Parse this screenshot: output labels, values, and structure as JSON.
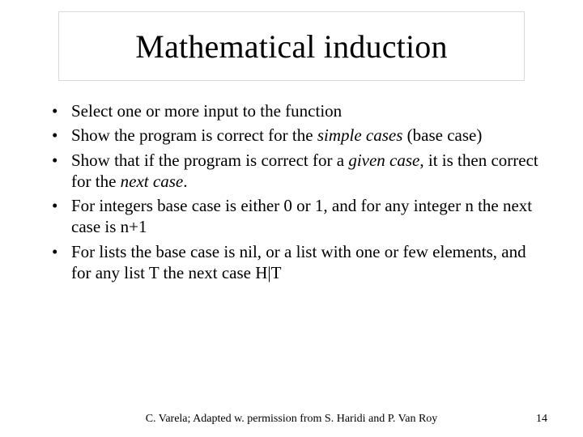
{
  "title": "Mathematical induction",
  "bullets": {
    "b1": "Select one or more input to the function",
    "b2a": "Show the program is correct for the ",
    "b2b": "simple cases",
    "b2c": " (base case)",
    "b3a": "Show that if the program is correct for a ",
    "b3b": "given case",
    "b3c": ", it is then correct for the ",
    "b3d": "next case",
    "b3e": ".",
    "b4": "For integers base case is either 0 or 1, and for any integer n the next case is n+1",
    "b5": "For lists the base case is nil, or a list with one or few elements, and for any list T the next case H|T"
  },
  "footer": {
    "center": "C. Varela;  Adapted w. permission from S. Haridi and P. Van Roy",
    "page": "14"
  }
}
